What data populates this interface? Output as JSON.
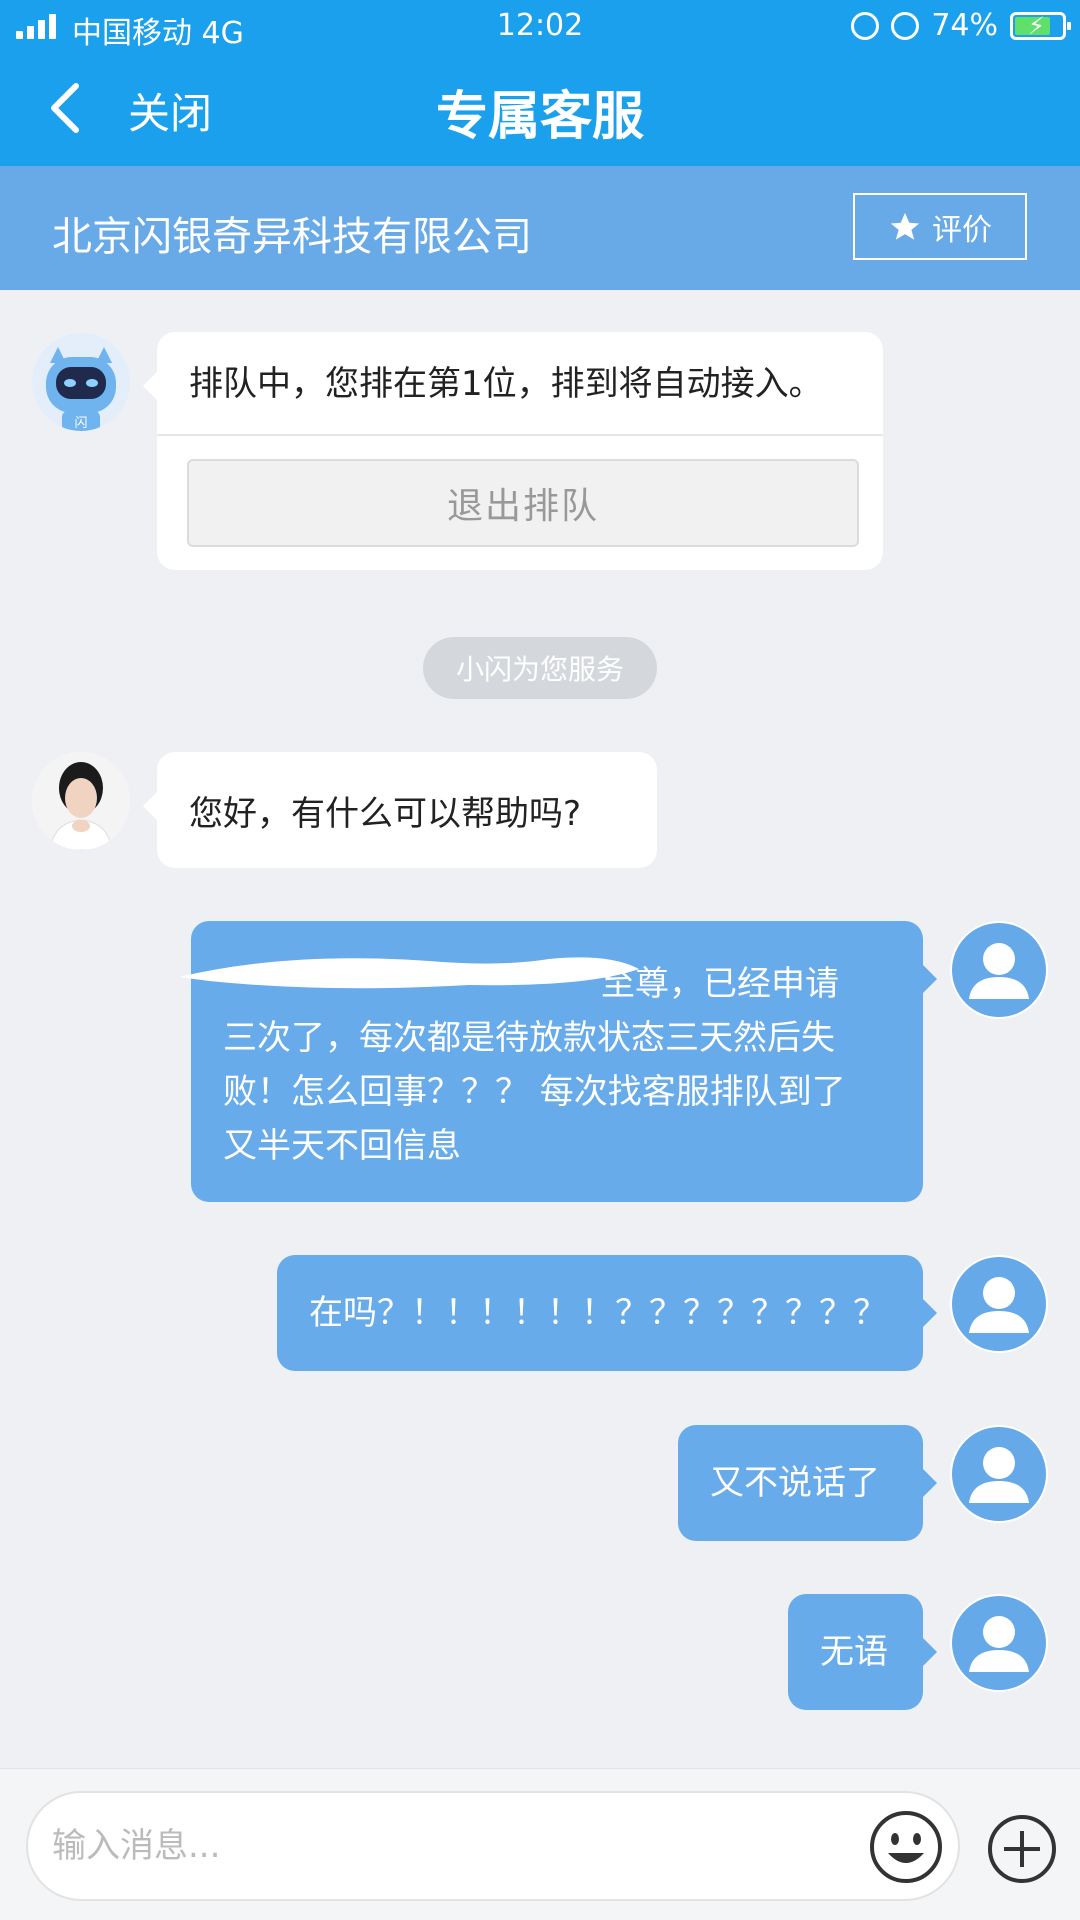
{
  "status_bar": {
    "carrier": "中国移动 4G",
    "time": "12:02",
    "battery": "74%",
    "battery_level": 0.74
  },
  "nav": {
    "close_label": "关闭",
    "title": "专属客服"
  },
  "company": {
    "name": "北京闪银奇异科技有限公司",
    "rate_label": "评价"
  },
  "queue_card": {
    "text": "排队中，您排在第1位，排到将自动接入。",
    "exit_button": "退出排队",
    "bot_badge": "闪"
  },
  "system_tag": "小闪为您服务",
  "agent_message": "您好，有什么可以帮助吗?",
  "user_messages": [
    {
      "lines": [
        "至尊，已经申请",
        "三次了，每次都是待放款状态三天然后失",
        "败！怎么回事？？？ 每次找客服排队到了",
        "又半天不回信息"
      ]
    },
    {
      "lines": [
        "在吗？！！！！！！？？？？？？？？"
      ]
    },
    {
      "lines": [
        "又不说话了"
      ]
    },
    {
      "lines": [
        "无语"
      ]
    }
  ],
  "input": {
    "placeholder": "输入消息..."
  },
  "colors": {
    "header_blue": "#1aa0ec",
    "company_bar": "#68a9e8",
    "user_bubble": "#67abea",
    "background": "#eef0f3"
  }
}
